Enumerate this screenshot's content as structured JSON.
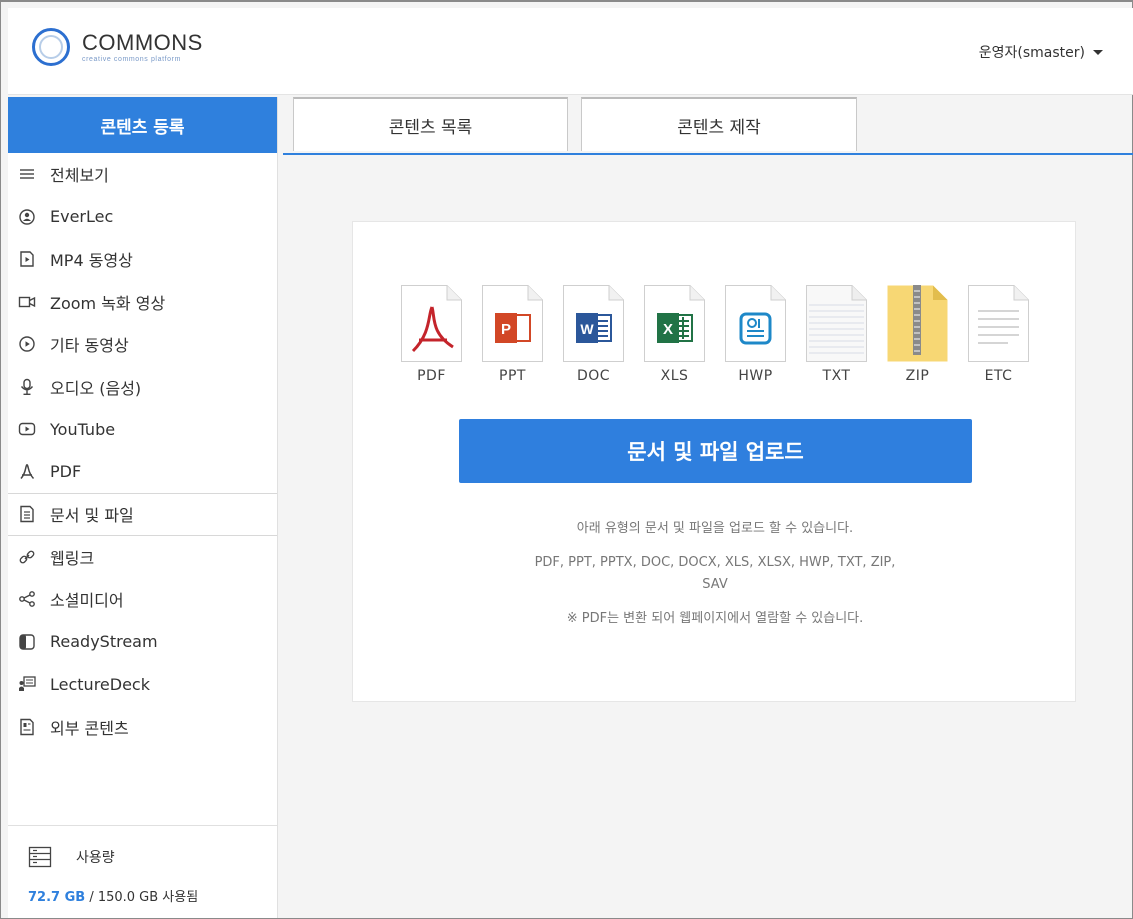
{
  "header": {
    "logo_name": "COMMONS",
    "logo_sub": "creative commons platform",
    "user": "운영자(smaster)"
  },
  "sidebar": {
    "title": "콘텐츠 등록",
    "items": [
      {
        "label": "전체보기",
        "icon": "list-icon"
      },
      {
        "label": "EverLec",
        "icon": "everlec-icon"
      },
      {
        "label": "MP4 동영상",
        "icon": "mp4-file-icon"
      },
      {
        "label": "Zoom 녹화 영상",
        "icon": "video-camera-icon"
      },
      {
        "label": "기타 동영상",
        "icon": "play-circle-icon"
      },
      {
        "label": "오디오 (음성)",
        "icon": "microphone-icon"
      },
      {
        "label": "YouTube",
        "icon": "youtube-icon"
      },
      {
        "label": "PDF",
        "icon": "pdf-icon"
      },
      {
        "label": "문서 및 파일",
        "icon": "document-icon"
      },
      {
        "label": "웹링크",
        "icon": "link-icon"
      },
      {
        "label": "소셜미디어",
        "icon": "share-icon"
      },
      {
        "label": "ReadyStream",
        "icon": "readystream-icon"
      },
      {
        "label": "LectureDeck",
        "icon": "lecturedeck-icon"
      },
      {
        "label": "외부 콘텐츠",
        "icon": "external-content-icon"
      }
    ],
    "active_index": 8,
    "usage": {
      "title": "사용량",
      "used": "72.7 GB",
      "rest": " / 150.0 GB 사용됨"
    }
  },
  "tabs": [
    {
      "label": "콘텐츠 목록"
    },
    {
      "label": "콘텐츠 제작"
    }
  ],
  "main": {
    "file_types": [
      "PDF",
      "PPT",
      "DOC",
      "XLS",
      "HWP",
      "TXT",
      "ZIP",
      "ETC"
    ],
    "upload_button": "문서 및 파일 업로드",
    "info_line1": "아래 유형의 문서 및 파일을 업로드 할 수 있습니다.",
    "info_line2a": "PDF, PPT, PPTX, DOC, DOCX, XLS, XLSX, HWP, TXT, ZIP,",
    "info_line2b": "SAV",
    "info_line3": "※ PDF는 변환 되어 웹페이지에서 열람할 수 있습니다."
  },
  "colors": {
    "accent": "#2f80dd",
    "pdf": "#c4242b",
    "ppt": "#d24726",
    "doc": "#2b579a",
    "xls": "#217346",
    "hwp": "#1e88c8",
    "zip": "#f7d774"
  }
}
